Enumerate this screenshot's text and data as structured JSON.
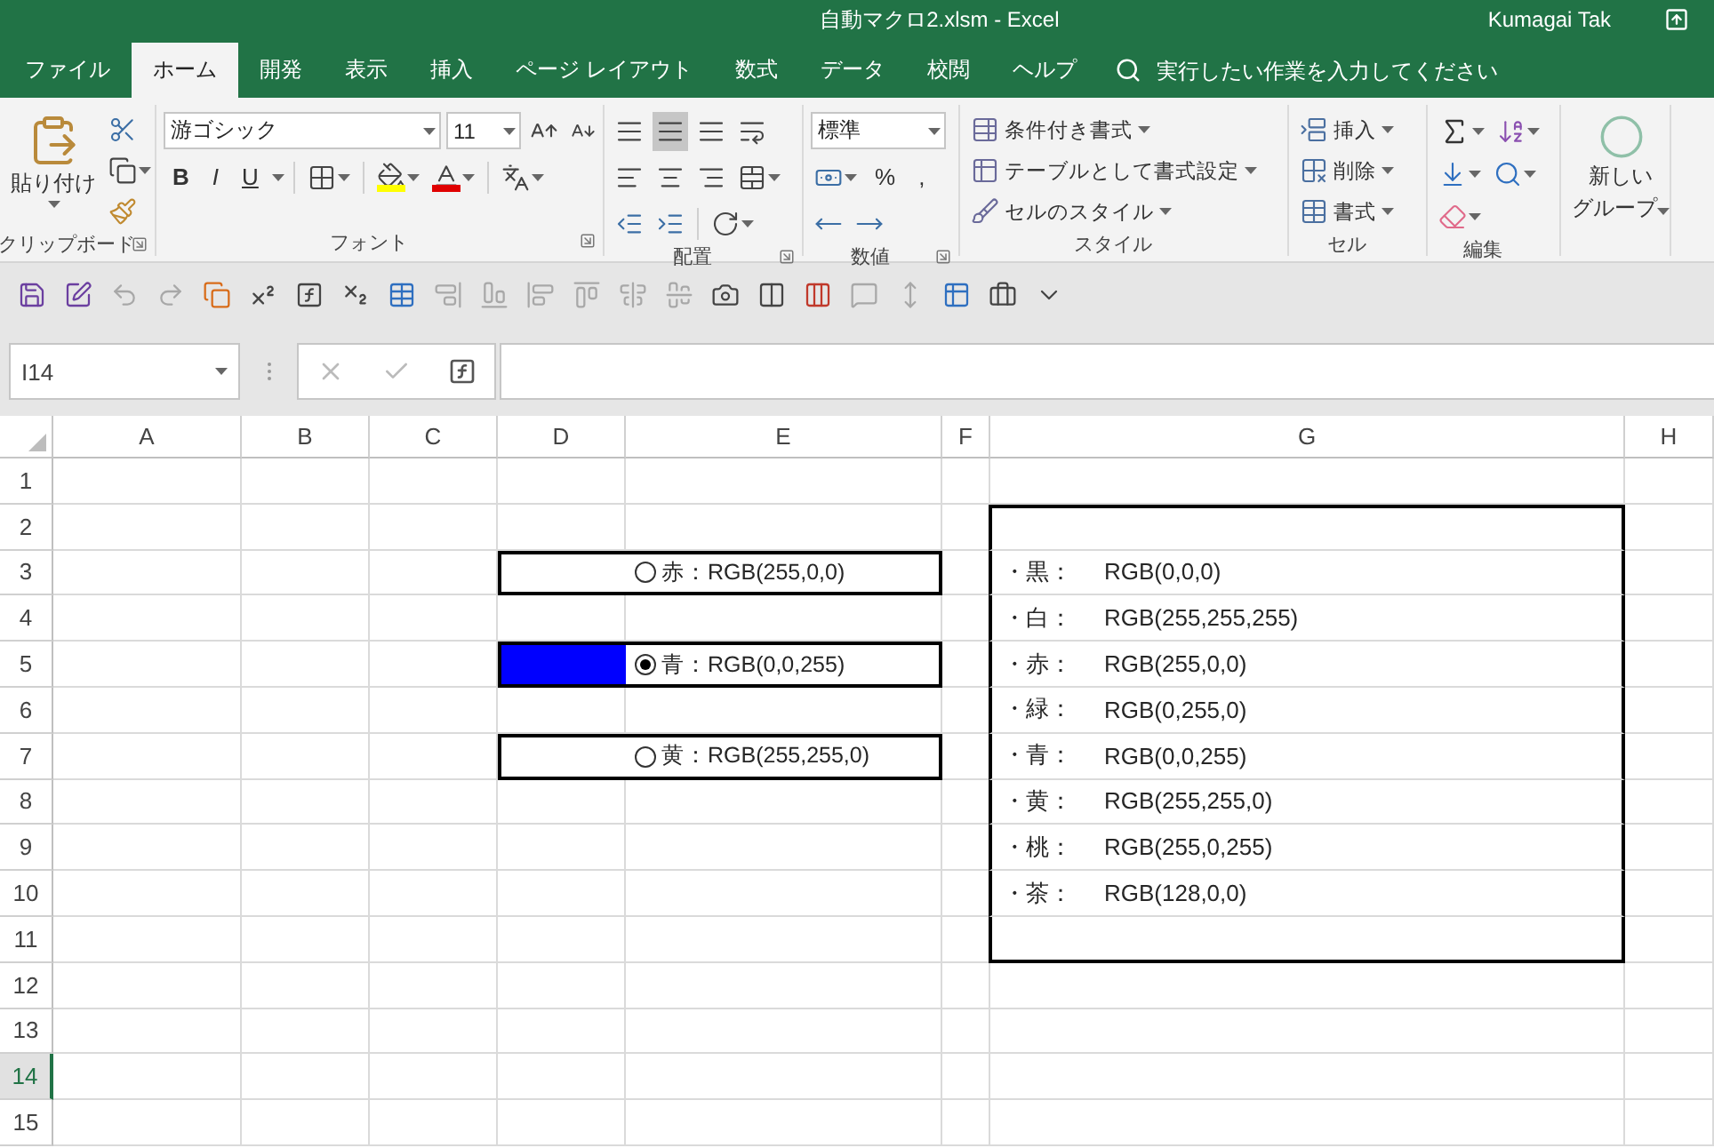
{
  "window": {
    "title": "自動マクロ2.xlsm  -  Excel",
    "user": "Kumagai Tak"
  },
  "tabs": [
    {
      "label": "ファイル",
      "selected": false
    },
    {
      "label": "ホーム",
      "selected": true
    },
    {
      "label": "開発",
      "selected": false
    },
    {
      "label": "表示",
      "selected": false
    },
    {
      "label": "挿入",
      "selected": false
    },
    {
      "label": "ページ レイアウト",
      "selected": false
    },
    {
      "label": "数式",
      "selected": false
    },
    {
      "label": "データ",
      "selected": false
    },
    {
      "label": "校閲",
      "selected": false
    },
    {
      "label": "ヘルプ",
      "selected": false
    }
  ],
  "tell_me": {
    "placeholder": "実行したい作業を入力してください"
  },
  "ribbon": {
    "groups": [
      {
        "kind": "clipboard",
        "title": "クリップボード",
        "launcher": true,
        "paste_label": "貼り付け"
      },
      {
        "kind": "font",
        "title": "フォント",
        "launcher": true,
        "font_name": "游ゴシック",
        "font_size": "11",
        "format_buttons": [
          "B",
          "I",
          "U"
        ]
      },
      {
        "kind": "alignment",
        "title": "配置",
        "launcher": true
      },
      {
        "kind": "number",
        "title": "数値",
        "launcher": true,
        "format": "標準",
        "symbols": [
          "%",
          ","
        ]
      },
      {
        "kind": "styles",
        "title": "スタイル",
        "items": [
          "条件付き書式",
          "テーブルとして書式設定",
          "セルのスタイル"
        ]
      },
      {
        "kind": "cells",
        "title": "セル",
        "items": [
          "挿入",
          "削除",
          "書式"
        ]
      },
      {
        "kind": "editing",
        "title": "編集"
      },
      {
        "kind": "custom",
        "button_lines": [
          "新しい",
          "グループ"
        ]
      }
    ]
  },
  "quick_access": [
    {
      "disabled": false
    },
    {
      "disabled": false
    },
    {
      "disabled": true
    },
    {
      "disabled": true
    },
    {
      "disabled": false
    },
    {
      "disabled": false
    },
    {
      "disabled": false
    },
    {
      "disabled": false
    },
    {
      "disabled": false
    },
    {
      "disabled": true
    },
    {
      "disabled": true
    },
    {
      "disabled": true
    },
    {
      "disabled": true
    },
    {
      "disabled": true
    },
    {
      "disabled": true
    },
    {
      "disabled": false
    },
    {
      "disabled": false
    },
    {
      "disabled": false
    },
    {
      "disabled": true
    },
    {
      "disabled": true
    },
    {
      "disabled": false
    },
    {
      "disabled": false
    },
    {
      "disabled": false
    }
  ],
  "formula_bar": {
    "name_box": "I14",
    "edit_buttons_disabled": true
  },
  "sheet": {
    "columns": [
      "A",
      "B",
      "C",
      "D",
      "E",
      "F",
      "G",
      "H"
    ],
    "rows": [
      {
        "label": "1",
        "selected": false
      },
      {
        "label": "2",
        "selected": false
      },
      {
        "label": "3",
        "selected": false
      },
      {
        "label": "4",
        "selected": false
      },
      {
        "label": "5",
        "selected": false
      },
      {
        "label": "6",
        "selected": false
      },
      {
        "label": "7",
        "selected": false
      },
      {
        "label": "8",
        "selected": false
      },
      {
        "label": "9",
        "selected": false
      },
      {
        "label": "10",
        "selected": false
      },
      {
        "label": "11",
        "selected": false
      },
      {
        "label": "12",
        "selected": false
      },
      {
        "label": "13",
        "selected": false
      },
      {
        "label": "14",
        "selected": true
      },
      {
        "label": "15",
        "selected": false
      }
    ],
    "option_buttons": [
      {
        "label": "赤：RGB(255,0,0)",
        "selected": false
      },
      {
        "label": "青：RGB(0,0,255)",
        "selected": true,
        "color": "#0000ff"
      },
      {
        "label": "黄：RGB(255,255,0)",
        "selected": false
      }
    ],
    "color_list": [
      {
        "name": "・黒：",
        "value": "RGB(0,0,0)"
      },
      {
        "name": "・白：",
        "value": "RGB(255,255,255)"
      },
      {
        "name": "・赤：",
        "value": "RGB(255,0,0)"
      },
      {
        "name": "・緑：",
        "value": "RGB(0,255,0)"
      },
      {
        "name": "・青：",
        "value": "RGB(0,0,255)"
      },
      {
        "name": "・黄：",
        "value": "RGB(255,255,0)"
      },
      {
        "name": "・桃：",
        "value": "RGB(255,0,255)"
      },
      {
        "name": "・茶：",
        "value": "RGB(128,0,0)"
      }
    ]
  }
}
